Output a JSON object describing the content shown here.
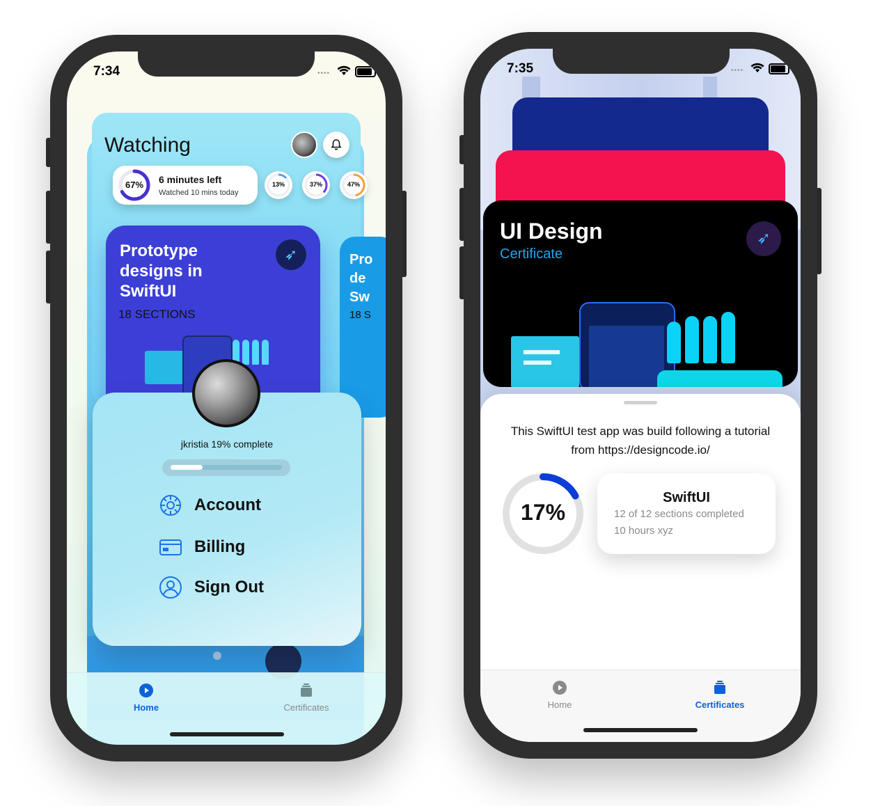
{
  "left_phone": {
    "status_time": "7:34",
    "header_title": "Watching",
    "progress_pill": {
      "percent": "67%",
      "title": "6 minutes left",
      "subtitle": "Watched 10 mins today"
    },
    "mini_rings": [
      "13%",
      "37%",
      "47%"
    ],
    "course_card": {
      "title": "Prototype designs in SwiftUI",
      "sections": "18 SECTIONS"
    },
    "peek_card": {
      "title": "Pro de Sw",
      "sections": "18 S"
    },
    "menu": {
      "progress_text": "jkristia 19% complete",
      "progress_value": 0.19,
      "items": [
        {
          "label": "Account",
          "icon": "gear-icon"
        },
        {
          "label": "Billing",
          "icon": "creditcard-icon"
        },
        {
          "label": "Sign Out",
          "icon": "person-icon"
        }
      ]
    },
    "tabs": [
      {
        "label": "Home",
        "icon": "play-circle-icon",
        "active": true
      },
      {
        "label": "Certificates",
        "icon": "stack-icon",
        "active": false
      }
    ]
  },
  "right_phone": {
    "status_time": "7:35",
    "certificate": {
      "title": "UI Design",
      "subtitle": "Certificate"
    },
    "description": "This SwiftUI test app was build following a tutorial from https://designcode.io/",
    "ring_percent": "17%",
    "ring_value": 0.17,
    "info_card": {
      "title": "SwiftUI",
      "line1": "12 of 12 sections completed",
      "line2": "10 hours xyz"
    },
    "tabs": [
      {
        "label": "Home",
        "icon": "play-circle-icon",
        "active": false
      },
      {
        "label": "Certificates",
        "icon": "stack-icon",
        "active": true
      }
    ]
  },
  "colors": {
    "accent_blue": "#0a63d8",
    "card_purple": "#3b3fd9",
    "menu_cyan": "#9fe4f4",
    "cert_pink": "#f4124f",
    "cert_navy": "#13298d"
  }
}
